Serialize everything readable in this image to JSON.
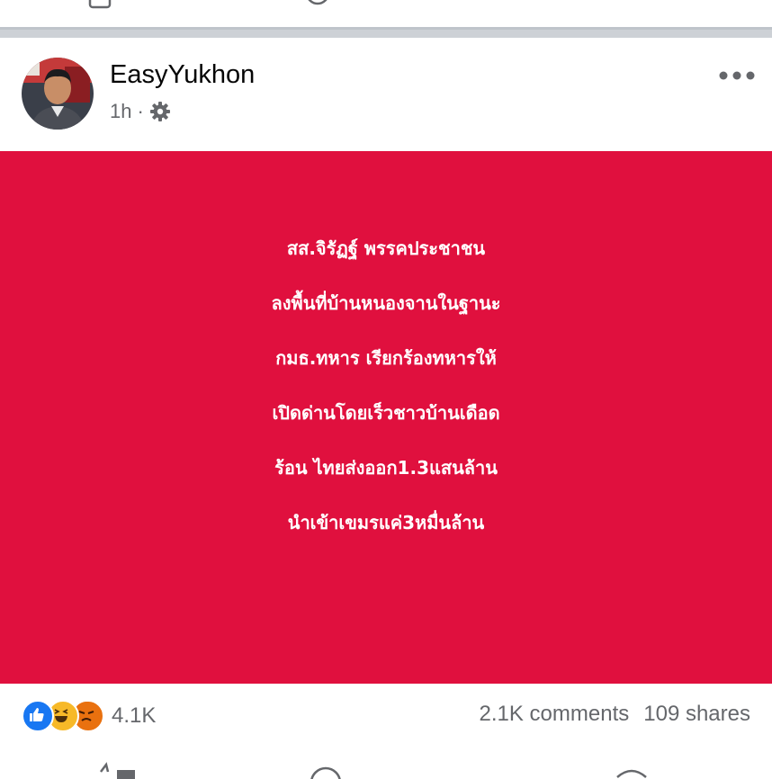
{
  "post": {
    "author": "EasyYukhon",
    "time": "1h",
    "separator": "·",
    "privacy_icon": "settings-gear-icon",
    "more_icon": "more-dots-icon",
    "image_text_lines": [
      "สส.จิรัฏฐ์ พรรคประชาชน",
      "ลงพื้นที่บ้านหนองจานในฐานะ",
      "กมธ.ทหาร เรียกร้องทหารให้",
      "เปิดด่านโดยเร็วชาวบ้านเดือด",
      "ร้อน ไทยส่งออก1.3แสนล้าน",
      "นำเข้าเขมรแค่3หมื่นล้าน"
    ],
    "image_background": "#e0103e"
  },
  "footer": {
    "reaction_count": "4.1K",
    "comments": "2.1K comments",
    "shares": "109 shares",
    "reaction_icons": [
      "like-icon",
      "haha-icon",
      "angry-icon"
    ]
  },
  "colors": {
    "like": "#1877f2",
    "haha": "#f7b928",
    "angry": "#e9710f",
    "muted_text": "#65676b",
    "separator": "#cdd1d6"
  }
}
